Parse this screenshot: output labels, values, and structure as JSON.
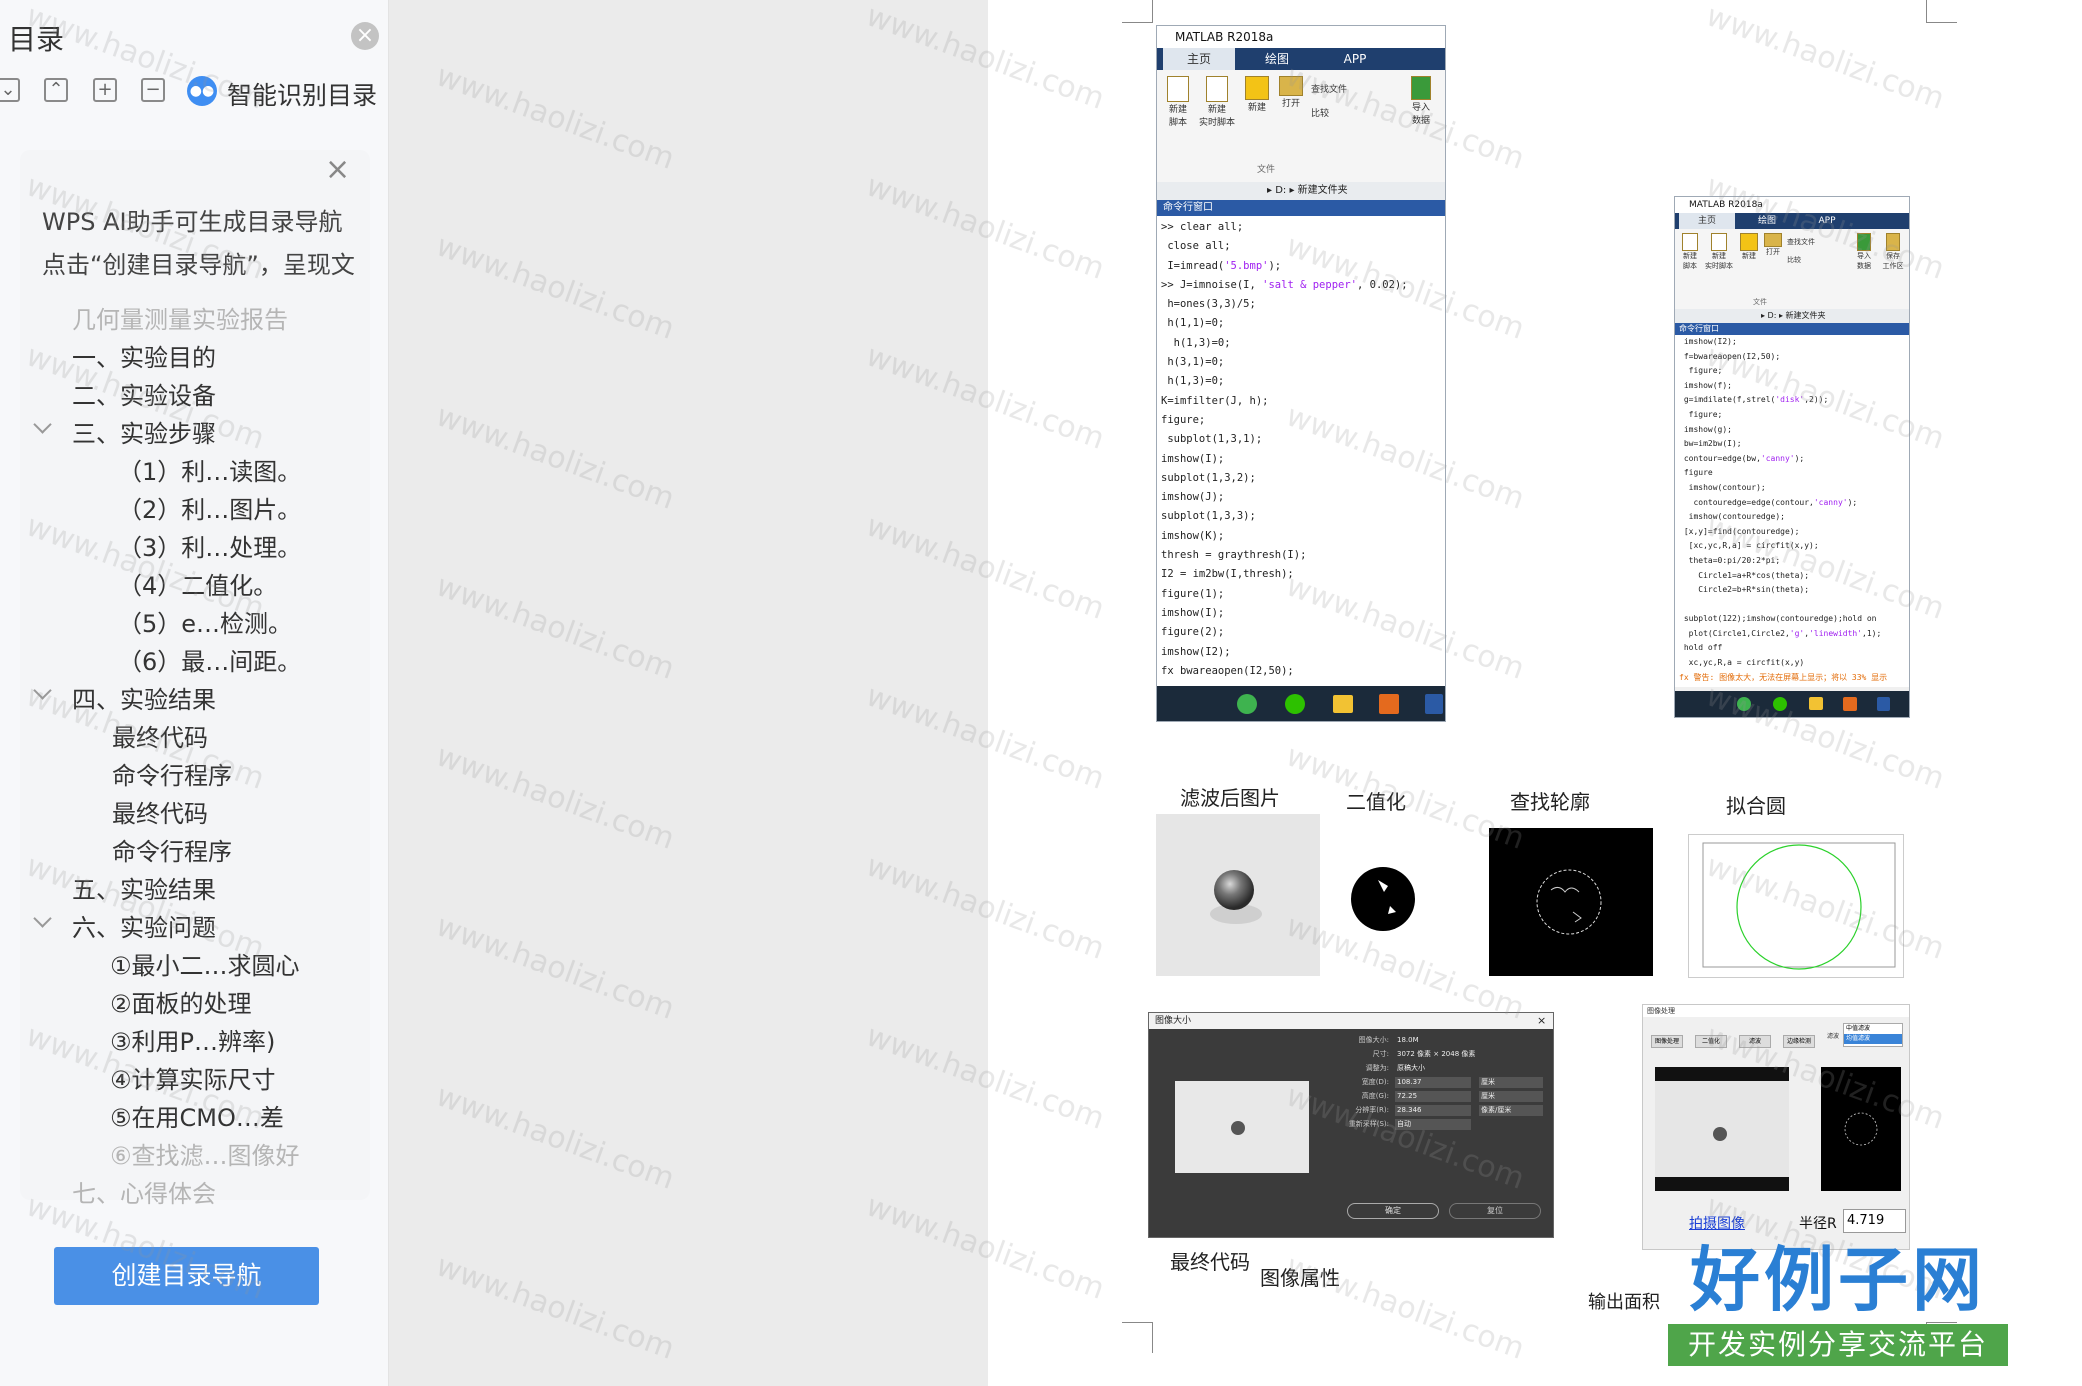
{
  "toc": {
    "title": "目录",
    "close_icon": "×",
    "toolbar": {
      "collapse": "⌄",
      "expand": "⌃",
      "add": "+",
      "remove": "−"
    },
    "smart_label": "智能识别目录",
    "ai_close": "×",
    "ai_tip_line1": "WPS AI助手可生成目录导航",
    "ai_tip_line2": "点击“创建目录导航”，呈现文档",
    "items": [
      "几何量测量实验报告",
      "一、实验目的",
      "二、实验设备",
      "三、实验步骤",
      "（1）利…读图。",
      "（2）利…图片。",
      "（3）利…处理。",
      "（4）二值化。",
      "（5）e…检测。",
      "（6）最…间距。",
      "四、实验结果",
      "最终代码",
      "命令行程序",
      "最终代码",
      "命令行程序",
      "五、实验结果",
      "六、实验问题",
      "①最小二…求圆心",
      "②面板的处理",
      "③利用P…辨率)",
      "④计算实际尺寸",
      "⑤在用CMO…差",
      "⑥查找滤…图像好",
      "七、心得体会"
    ],
    "create_button": "创建目录导航"
  },
  "document": {
    "matlab1": {
      "title": "MATLAB R2018a",
      "tabs": [
        "主页",
        "绘图",
        "APP"
      ],
      "ribbon": [
        "新建\n脚本",
        "新建\n实时脚本",
        "新建",
        "打开",
        "查找文件",
        "比较",
        "导入\n数据"
      ],
      "section": "文件",
      "path": "▸ D: ▸ 新建文件夹",
      "cmd_header": "命令行窗口",
      "code": [
        ">> clear all;",
        " close all;",
        " I=imread('5.bmp');",
        ">> J=imnoise(I, 'salt & pepper', 0.02);",
        " h=ones(3,3)/5;",
        " h(1,1)=0;",
        "  h(1,3)=0;",
        " h(3,1)=0;",
        " h(1,3)=0;",
        "K=imfilter(J, h);",
        "figure;",
        " subplot(1,3,1);",
        "imshow(I);",
        "subplot(1,3,2);",
        "imshow(J);",
        "subplot(1,3,3);",
        "imshow(K);",
        "thresh = graythresh(I);",
        "I2 = im2bw(I,thresh);",
        "figure(1);",
        "imshow(I);",
        "figure(2);",
        "imshow(I2);",
        "fx bwareaopen(I2,50);"
      ]
    },
    "matlab2": {
      "title": "MATLAB R2018a",
      "tabs": [
        "主页",
        "绘图",
        "APP"
      ],
      "ribbon": [
        "新建\n脚本",
        "新建\n实时脚本",
        "新建",
        "打开",
        "查找文件",
        "比较",
        "导入\n数据",
        "保存\n工作区"
      ],
      "section": "文件",
      "path": "▸ D: ▸ 新建文件夹",
      "cmd_header": "命令行窗口",
      "code": [
        " imshow(I2);",
        " f=bwareaopen(I2,50);",
        "  figure;",
        " imshow(f);",
        " g=imdilate(f,strel('disk',2));",
        "  figure;",
        " imshow(g);",
        " bw=im2bw(I);",
        " contour=edge(bw,'canny');",
        " figure",
        "  imshow(contour);",
        "   contouredge=edge(contour,'canny');",
        "  imshow(contouredge);",
        " [x,y]=find(contouredge);",
        "  [xc,yc,R,a] = circfit(x,y);",
        "  theta=0:pi/20:2*pi;",
        "    Circle1=a+R*cos(theta);",
        "    Circle2=b+R*sin(theta);",
        "",
        " subplot(122);imshow(contouredge);hold on",
        "  plot(Circle1,Circle2,'g','linewidth',1);",
        " hold off",
        "  xc,yc,R,a = circfit(x,y)",
        "fx 警告: 图像太大，无法在屏幕上显示；将以 33% 显示"
      ]
    },
    "captions": {
      "filtered": "滤波后图片",
      "binary": "二值化",
      "contour": "查找轮廓",
      "fit_circle": "拟合圆",
      "final_code": "最终代码",
      "image_props": "图像属性"
    },
    "image_size_dialog": {
      "title": "图像大小",
      "rows": [
        {
          "label": "图像大小:",
          "value": "18.0M"
        },
        {
          "label": "尺寸:",
          "value": "3072 像素 × 2048 像素"
        },
        {
          "label": "调整为:",
          "value": "原稿大小"
        },
        {
          "label": "宽度(D):",
          "value": "108.37",
          "unit": "厘米"
        },
        {
          "label": "高度(G):",
          "value": "72.25",
          "unit": "厘米"
        },
        {
          "label": "分辨率(R):",
          "value": "28.346",
          "unit": "像素/厘米"
        },
        {
          "label": "重新采样(S):",
          "value": "自动"
        }
      ],
      "ok": "确定",
      "cancel": "复位"
    },
    "app_panel": {
      "title": "图像处理",
      "buttons": [
        "图像处理",
        "二值化",
        "滤波",
        "边缘检测"
      ],
      "select_label": "滤波",
      "select_options": [
        "中值滤波",
        "均值滤波"
      ],
      "link": "拍摄图像",
      "radius_label": "半径R",
      "radius_value": "4.719",
      "output": "输出面积"
    }
  },
  "watermark": "www.haolizi.com",
  "logo": {
    "main": "好例子网",
    "sub": "开发实例分享交流平台"
  },
  "colors": {
    "accent": "#4a90e6",
    "matlab_blue": "#1f3f6e",
    "logo_blue": "#2a7fd4",
    "logo_green": "#4fa54a"
  }
}
